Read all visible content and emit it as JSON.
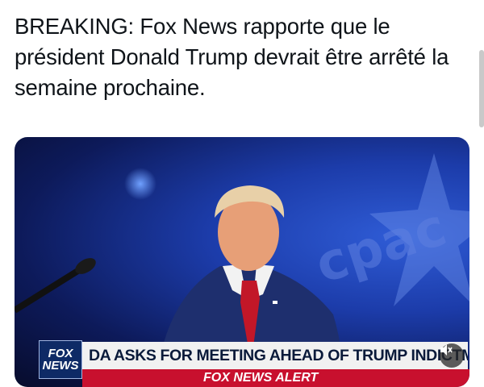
{
  "post": {
    "text": "BREAKING: Fox News rapporte que le président Donald Trump devrait être arrêté la semaine prochaine."
  },
  "media": {
    "logo_line1": "FOX",
    "logo_line2": "NEWS",
    "headline": "DA ASKS FOR MEETING AHEAD OF TRUMP INDICTMEN",
    "alert": "FOX NEWS ALERT",
    "mute_icon": "speaker-muted-icon"
  }
}
